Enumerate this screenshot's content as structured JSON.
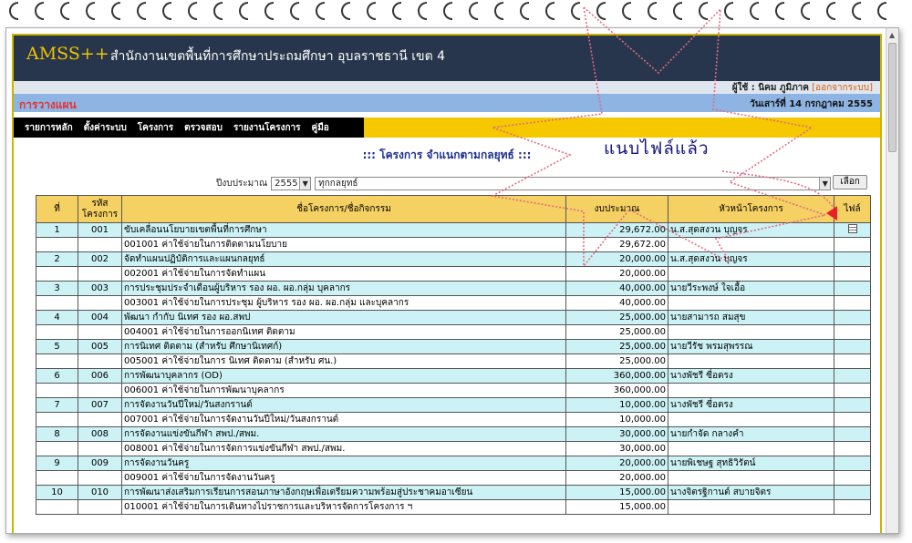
{
  "app": {
    "logo": "AMSS++",
    "org": "สำนักงานเขตพื้นที่การศึกษาประถมศึกษา อุบลราชธานี เขต 4"
  },
  "userbar": {
    "user": "ผู้ใช้ : นิคม ภูมิภาค",
    "logout": "[ออกจากระบบ]"
  },
  "planbar": {
    "title": "การวางแผน",
    "date": "วันเสาร์ที่ 14 กรกฎาคม 2555"
  },
  "menu": [
    "รายการหลัก",
    "ตั้งค่าระบบ",
    "โครงการ",
    "ตรวจสอบ",
    "รายงานโครงการ",
    "คู่มือ"
  ],
  "page_title": "::: โครงการ จำแนกตามกลยุทธ์ :::",
  "annotation": "แนบไฟล์แล้ว",
  "filter": {
    "label": "ปีงบประมาณ",
    "year": "2555",
    "strategy": "ทุกกลยุทธ์",
    "button": "เลือก"
  },
  "table": {
    "headers": [
      "ที่",
      "รหัส\nโครงการ",
      "ชื่อโครงการ/ชื่อกิจกรรม",
      "งบประมาณ",
      "หัวหน้าโครงการ",
      "ไฟล์"
    ],
    "rows": [
      {
        "no": "1",
        "code": "001",
        "name": "ขับเคลื่อนนโยบายเขตพื้นที่การศึกษา",
        "budget": "29,672.00",
        "head": "น.ส.สุดสงวน บุญจร",
        "sub_name": "001001 ค่าใช้จ่ายในการติดตามนโยบาย",
        "sub_budget": "29,672.00",
        "file": true
      },
      {
        "no": "2",
        "code": "002",
        "name": "จัดทำแผนปฏิบัติการและแผนกลยุทธ์",
        "budget": "20,000.00",
        "head": "น.ส.สุดสงวน บุญจร",
        "sub_name": "002001 ค่าใช้จ่ายในการจัดทำแผน",
        "sub_budget": "20,000.00",
        "file": false
      },
      {
        "no": "3",
        "code": "003",
        "name": "การประชุมประจำเดือนผู้บริหาร รอง ผอ. ผอ.กลุ่ม บุคลากร",
        "budget": "40,000.00",
        "head": "นายวีระพงษ์ ใจเอื้อ",
        "sub_name": "003001 ค่าใช้จ่ายในการประชุม ผู้บริหาร รอง ผอ. ผอ.กลุ่ม และบุคลากร",
        "sub_budget": "40,000.00",
        "file": false
      },
      {
        "no": "4",
        "code": "004",
        "name": "พัฒนา กำกับ นิเทศ รอง ผอ.สพป",
        "budget": "25,000.00",
        "head": "นายสามารถ สมสุข",
        "sub_name": "004001 ค่าใช้จ่ายในการออกนิเทศ ติดตาม",
        "sub_budget": "25,000.00",
        "file": false
      },
      {
        "no": "5",
        "code": "005",
        "name": "การนิเทศ ติดตาม (สำหรับ ศึกษานิเทศก์)",
        "budget": "25,000.00",
        "head": "นายวีรัช พรมสุพรรณ",
        "sub_name": "005001 ค่าใช้จ่ายในการ นิเทศ ติดตาม (สำหรับ ศน.)",
        "sub_budget": "25,000.00",
        "file": false
      },
      {
        "no": "6",
        "code": "006",
        "name": "การพัฒนาบุคลากร (OD)",
        "budget": "360,000.00",
        "head": "นางพัชรี ซื่อตรง",
        "sub_name": "006001 ค่าใช้จ่ายในการพัฒนาบุคลากร",
        "sub_budget": "360,000.00",
        "file": false
      },
      {
        "no": "7",
        "code": "007",
        "name": "การจัดงานวันปีใหม่/วันสงกรานต์",
        "budget": "10,000.00",
        "head": "นางพัชรี ซื่อตรง",
        "sub_name": "007001 ค่าใช้จ่ายในการจัดงานวันปีใหม่/วันสงกรานต์",
        "sub_budget": "10,000.00",
        "file": false
      },
      {
        "no": "8",
        "code": "008",
        "name": "การจัดงานแข่งขันกีฬา สพป./สพม.",
        "budget": "30,000.00",
        "head": "นายกำจัด กลางคำ",
        "sub_name": "008001 ค่าใช้จ่ายในการจัดการแข่งขันกีฬา สพป./สพม.",
        "sub_budget": "30,000.00",
        "file": false
      },
      {
        "no": "9",
        "code": "009",
        "name": "การจัดงานวันครู",
        "budget": "20,000.00",
        "head": "นายพิเชษฐ สุทธิวิรัตน์",
        "sub_name": "009001 ค่าใช้จ่ายในการจัดงานวันครู",
        "sub_budget": "20,000.00",
        "file": false
      },
      {
        "no": "10",
        "code": "010",
        "name": "การพัฒนาส่งเสริมการเรียนการสอนภาษาอังกฤษเพื่อเตรียมความพร้อมสู่ประชาคมอาเซียน",
        "budget": "15,000.00",
        "head": "นางจิตรฐิกานต์ สบายจิตร",
        "sub_name": "010001 ค่าใช้จ่ายในการเดินทางไปราชการและบริหารจัดการโครงการ ฯ",
        "sub_budget": "15,000.00",
        "file": false
      }
    ]
  }
}
